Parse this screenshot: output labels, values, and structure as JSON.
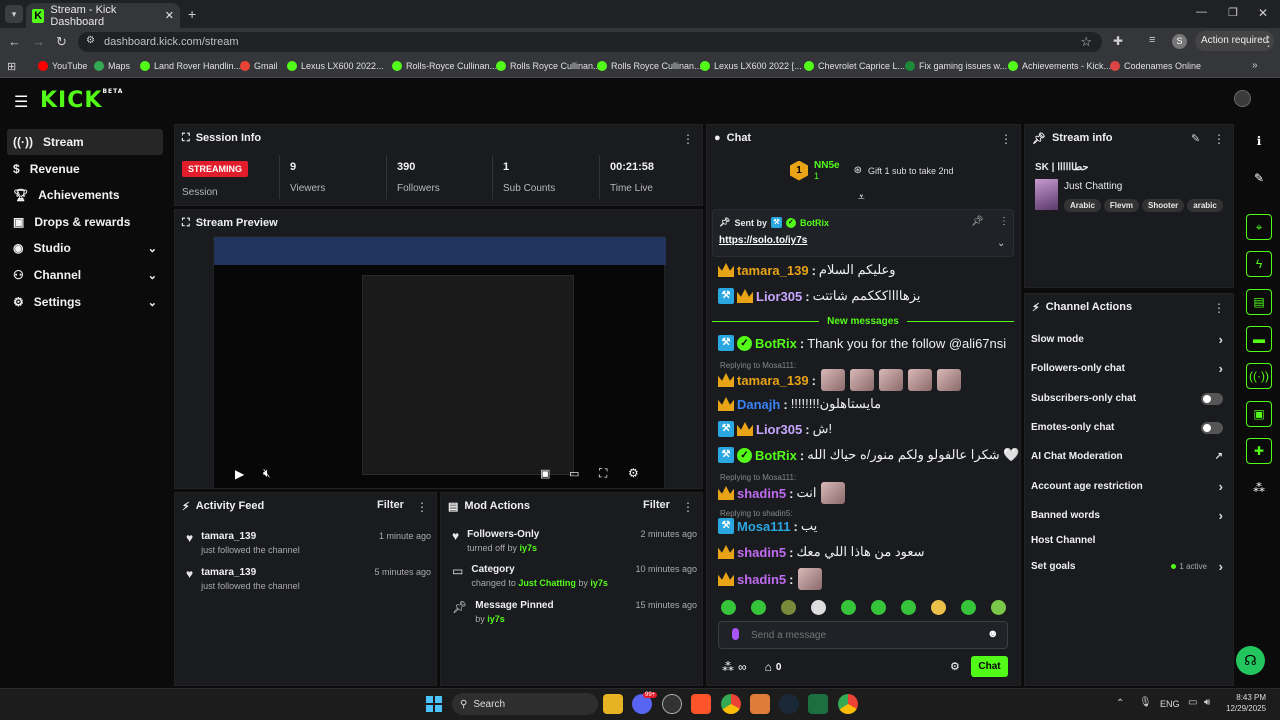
{
  "browser": {
    "tab_title": "Stream - Kick Dashboard",
    "url": "dashboard.kick.com/stream",
    "action_required": "Action required",
    "profile_initial": "S",
    "bookmarks": [
      "YouTube",
      "Maps",
      "Land Rover Handlin...",
      "Gmail",
      "Lexus LX600 2022...",
      "Rolls-Royce Cullinan...",
      "Rolls Royce Cullinan...",
      "Rolls Royce Cullinan...",
      "Lexus LX600 2022 [...",
      "Chevrolet Caprice L...",
      "Fix gaming issues w...",
      "Achievements - Kick...",
      "Codenames Online"
    ]
  },
  "header": {
    "logo": "KICK",
    "logo_sup": "BETA"
  },
  "sidebar": {
    "items": [
      {
        "label": "Stream"
      },
      {
        "label": "Revenue"
      },
      {
        "label": "Achievements"
      },
      {
        "label": "Drops & rewards"
      },
      {
        "label": "Studio"
      },
      {
        "label": "Channel"
      },
      {
        "label": "Settings"
      }
    ]
  },
  "session": {
    "title": "Session Info",
    "status": "STREAMING",
    "status_label": "Session",
    "stats": [
      {
        "value": "9",
        "label": "Viewers"
      },
      {
        "value": "390",
        "label": "Followers"
      },
      {
        "value": "1",
        "label": "Sub Counts"
      },
      {
        "value": "00:21:58",
        "label": "Time Live"
      }
    ]
  },
  "preview": {
    "title": "Stream Preview"
  },
  "activity": {
    "title": "Activity Feed",
    "filter": "Filter",
    "items": [
      {
        "name": "tamara_139",
        "desc": "just followed the channel",
        "time": "1 minute ago"
      },
      {
        "name": "tamara_139",
        "desc": "just followed the channel",
        "time": "5 minutes ago"
      }
    ]
  },
  "mod": {
    "title": "Mod Actions",
    "filter": "Filter",
    "items": [
      {
        "title": "Followers-Only",
        "pre": "turned off by ",
        "target": "",
        "by": "iy7s",
        "time": "2 minutes ago"
      },
      {
        "title": "Category",
        "pre": "changed to ",
        "target": "Just Chatting",
        "by": "iy7s",
        "time": "10 minutes ago"
      },
      {
        "title": "Message Pinned",
        "pre": "by ",
        "target": "",
        "by": "iy7s",
        "time": "15 minutes ago"
      }
    ]
  },
  "chat": {
    "title": "Chat",
    "gifter_name": "NN5e",
    "gifter_count": "1",
    "gift_label": "Gift 1 sub to take 2nd",
    "pinned_by_prefix": "Sent by",
    "pinned_by": "BotRix",
    "pinned_link": "https://solo.to/iy7s",
    "new_messages": "New messages",
    "messages": [
      {
        "user": "tamara_139",
        "text": "وعليكم السلام",
        "color": "#e8a317"
      },
      {
        "user": "Lior305",
        "text": "يزهااااكككمم شاتتت",
        "color": "#c9a6ff"
      },
      {
        "user": "BotRix",
        "text": "Thank you for the follow @ali67nsi",
        "color": "#53fc18"
      },
      {
        "user": "tamara_139",
        "text": "",
        "color": "#e8a317",
        "reply": "Replying to Mosa111:"
      },
      {
        "user": "Danajh",
        "text": "!!!!!!!!مايستاهلون",
        "color": "#3b82f6"
      },
      {
        "user": "Lior305",
        "text": "ش!",
        "color": "#c9a6ff"
      },
      {
        "user": "BotRix",
        "text": "شكرا عالفولو ولكم منور/ه حياك الله 🤍",
        "color": "#53fc18"
      },
      {
        "user": "shadin5",
        "text": "انت",
        "color": "#c06cf0",
        "reply": "Replying to Mosa111:"
      },
      {
        "user": "Mosa111",
        "text": "يب",
        "color": "#2aa7e0",
        "reply": "Replying to shadin5:"
      },
      {
        "user": "shadin5",
        "text": "سعود من هاذا اللي معك",
        "color": "#c06cf0"
      },
      {
        "user": "shadin5",
        "text": "",
        "color": "#c06cf0"
      }
    ],
    "input_placeholder": "Send a message",
    "infinity": "∞",
    "store_count": "0",
    "send_label": "Chat"
  },
  "stream_info": {
    "title": "Stream info",
    "stream_title": "SK | حطاااااا",
    "category": "Just Chatting",
    "tags": [
      "Arabic",
      "Flevm",
      "Shooter",
      "arabic"
    ]
  },
  "actions": {
    "title": "Channel Actions",
    "items": [
      {
        "label": "Slow mode"
      },
      {
        "label": "Followers-only chat"
      },
      {
        "label": "Subscribers-only chat"
      },
      {
        "label": "Emotes-only chat"
      },
      {
        "label": "AI Chat Moderation"
      },
      {
        "label": "Account age restriction"
      },
      {
        "label": "Banned words"
      },
      {
        "label": "Host Channel"
      },
      {
        "label": "Set goals"
      }
    ],
    "goals_status": "1 active"
  },
  "taskbar": {
    "search": "Search",
    "lang": "ENG",
    "time": "8:43 PM",
    "date": "12/29/2025",
    "badge": "99+"
  },
  "colors": {
    "accent": "#53fc18",
    "streaming": "#e11d2b",
    "panel": "#191b1f"
  }
}
